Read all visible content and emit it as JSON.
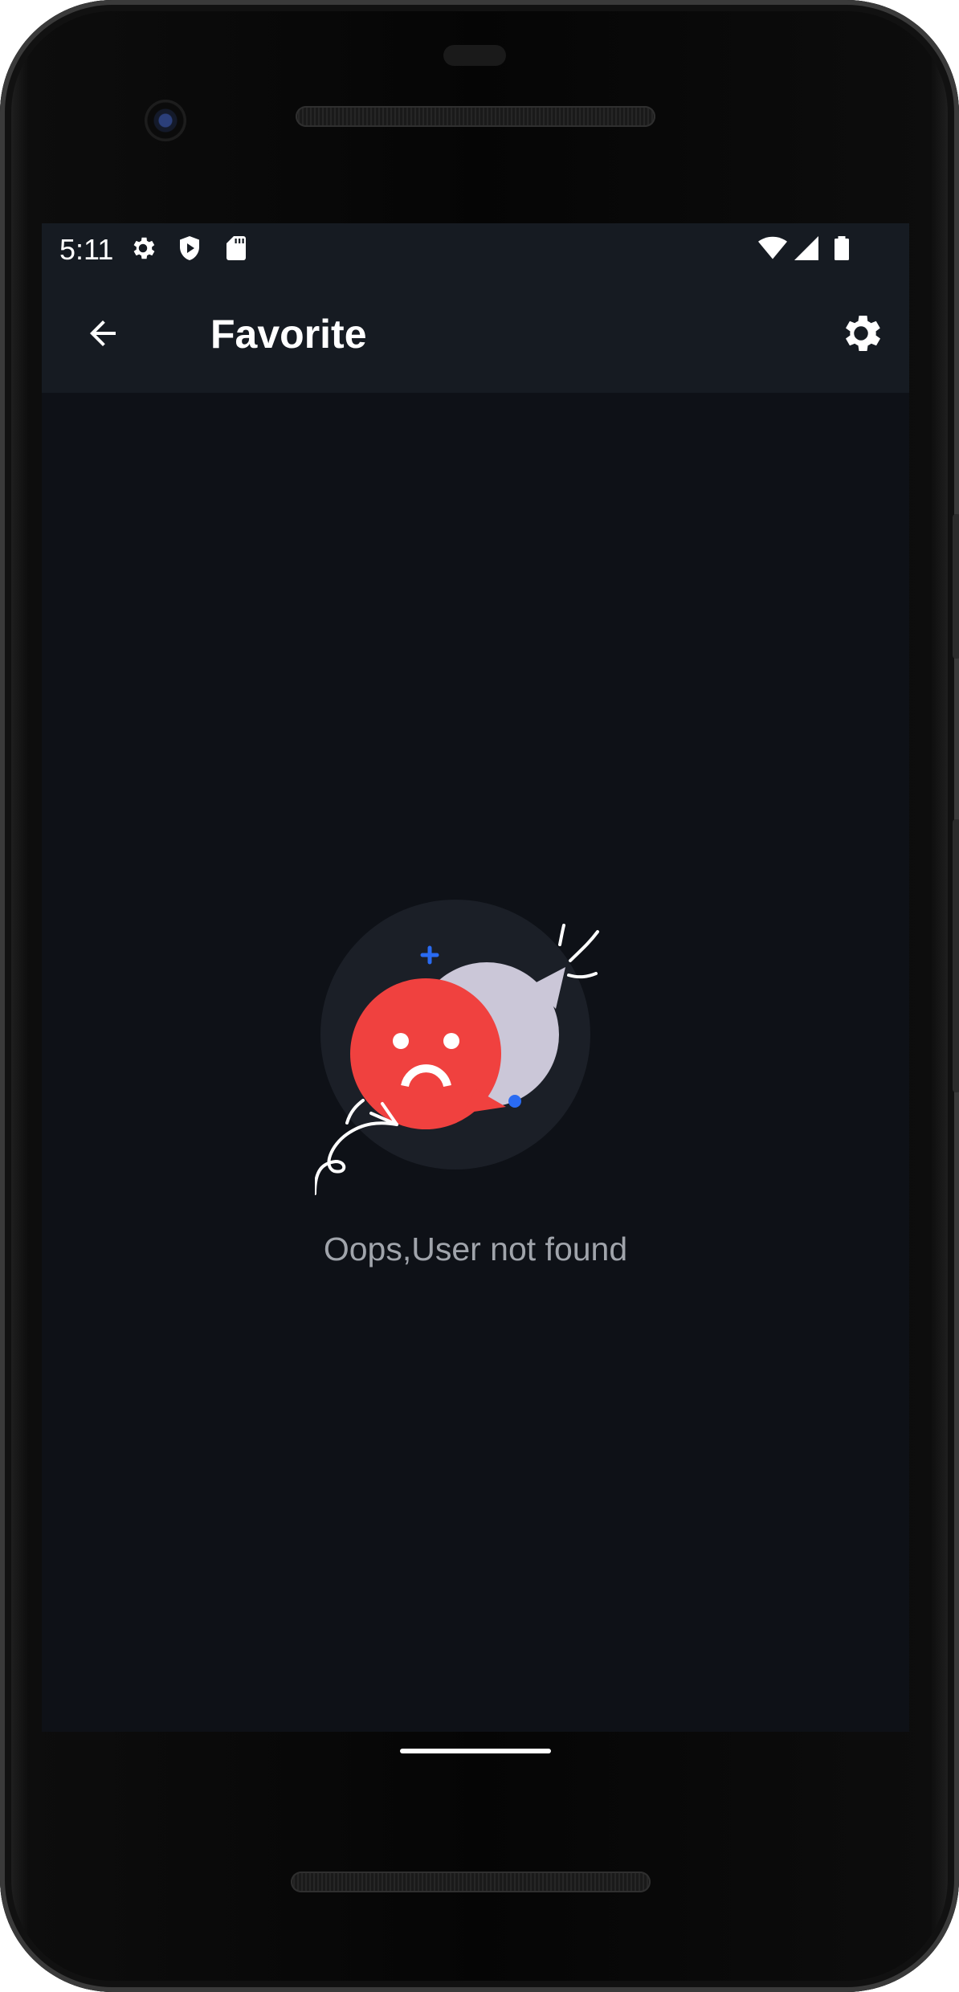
{
  "status_bar": {
    "time": "5:11",
    "left_icons": [
      "gear-icon",
      "shield-play-icon",
      "sd-card-icon"
    ],
    "right_icons": [
      "wifi-icon",
      "signal-icon",
      "battery-icon"
    ]
  },
  "app_bar": {
    "title": "Favorite",
    "back_icon": "arrow-left-icon",
    "settings_icon": "gear-icon"
  },
  "empty_state": {
    "message": "Oops,User not found",
    "illustration": "sad-chat-bubbles-illustration"
  },
  "colors": {
    "screen_bg": "#0e1117",
    "app_bar_bg": "#161b22",
    "accent_red": "#f0413f",
    "accent_blue": "#2a6bf2",
    "bubble_grey": "#cbc7d8",
    "message_text": "#a0a4ab"
  }
}
